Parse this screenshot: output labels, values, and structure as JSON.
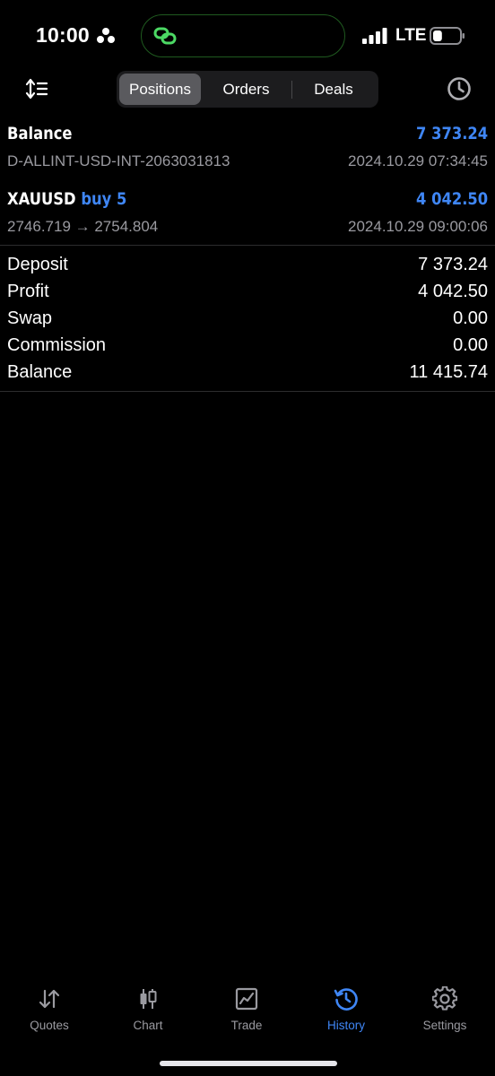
{
  "status": {
    "time": "10:00",
    "network": "LTE",
    "battery_level": 0.35
  },
  "segment": {
    "tabs": [
      "Positions",
      "Orders",
      "Deals"
    ],
    "active_index": 0
  },
  "balance_row": {
    "title": "Balance",
    "amount": "7 373.24",
    "account": "D-ALLINT-USD-INT-2063031813",
    "datetime": "2024.10.29 07:34:45"
  },
  "deal_row": {
    "symbol": "XAUUSD",
    "direction": "buy 5",
    "amount": "4 042.50",
    "prices": "2746.719 → 2754.804",
    "datetime": "2024.10.29 09:00:06"
  },
  "summary": [
    {
      "label": "Deposit",
      "value": "7 373.24"
    },
    {
      "label": "Profit",
      "value": "4 042.50"
    },
    {
      "label": "Swap",
      "value": "0.00"
    },
    {
      "label": "Commission",
      "value": "0.00"
    },
    {
      "label": "Balance",
      "value": "11 415.74"
    }
  ],
  "tabbar": {
    "items": [
      {
        "label": "Quotes",
        "icon": "quotes-arrows-icon"
      },
      {
        "label": "Chart",
        "icon": "candlestick-chart-icon"
      },
      {
        "label": "Trade",
        "icon": "trade-chart-icon"
      },
      {
        "label": "History",
        "icon": "history-clock-icon"
      },
      {
        "label": "Settings",
        "icon": "gear-icon"
      }
    ],
    "active_index": 3
  },
  "colors": {
    "accent": "#3f86f5",
    "background": "#000000",
    "secondary_text": "#9a9aa0",
    "island_accent": "#4cd964"
  }
}
